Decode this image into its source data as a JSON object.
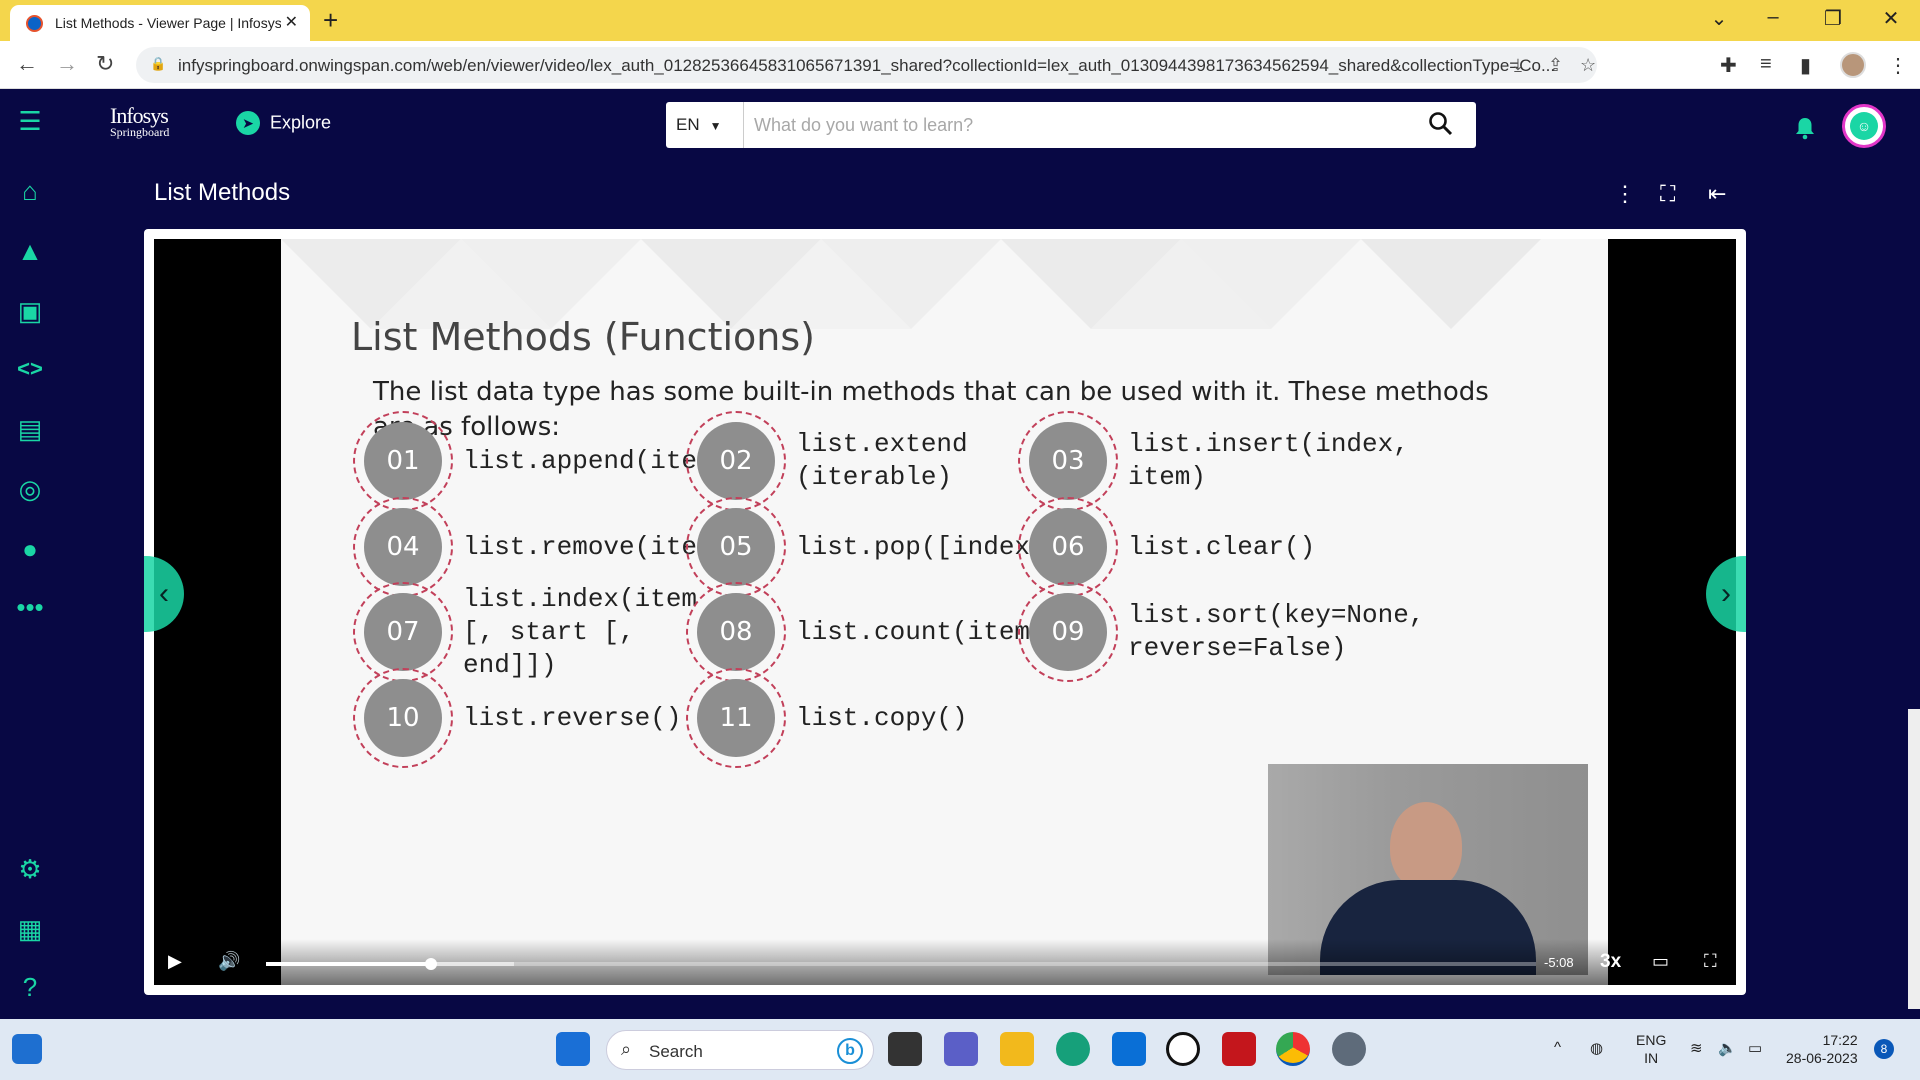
{
  "browser": {
    "tab_title": "List Methods - Viewer Page | Infosys",
    "url": "infyspringboard.onwingspan.com/web/en/viewer/video/lex_auth_01282536645831065671391_shared?collectionId=lex_auth_0130944398173634562594_shared&collectionType=Co..."
  },
  "header": {
    "logo_line1": "Infosys",
    "logo_line2": "Springboard",
    "explore_label": "Explore",
    "language": "EN",
    "search_placeholder": "What do you want to learn?"
  },
  "page": {
    "title": "List Methods"
  },
  "slide": {
    "title": "List Methods (Functions)",
    "intro": "The list data type has some built-in methods that can be used with it. These methods are as follows:",
    "methods": [
      {
        "num": "01",
        "text": "list.append(item)"
      },
      {
        "num": "02",
        "text": "list.extend\n(iterable)"
      },
      {
        "num": "03",
        "text": "list.insert(index,\nitem)"
      },
      {
        "num": "04",
        "text": "list.remove(item)"
      },
      {
        "num": "05",
        "text": "list.pop([index])"
      },
      {
        "num": "06",
        "text": "list.clear()"
      },
      {
        "num": "07",
        "text": "list.index(item\n[, start [,\nend]])"
      },
      {
        "num": "08",
        "text": "list.count(item)"
      },
      {
        "num": "09",
        "text": "list.sort(key=None,\nreverse=False)"
      },
      {
        "num": "10",
        "text": "list.reverse()"
      },
      {
        "num": "11",
        "text": "list.copy()"
      }
    ]
  },
  "player": {
    "time_remaining": "-5:08",
    "speed": "3x",
    "progress": 0.13,
    "buffered": 0.195
  },
  "taskbar": {
    "search_label": "Search",
    "lang_line1": "ENG",
    "lang_line2": "IN",
    "time": "17:22",
    "date": "28-06-2023",
    "notification_count": "8"
  },
  "colors": {
    "accent": "#1ad6a5",
    "app_bg": "#080844",
    "badge_ring": "#c2405a"
  }
}
